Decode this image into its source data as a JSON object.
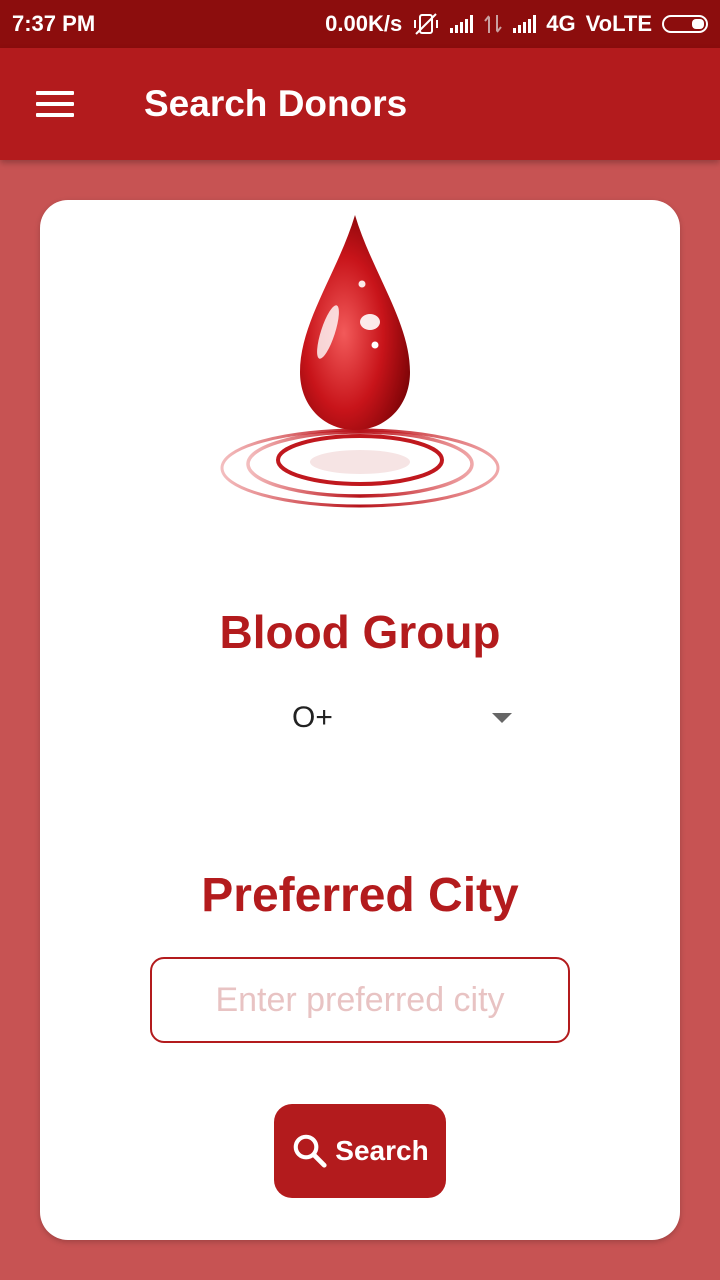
{
  "status_bar": {
    "time": "7:37 PM",
    "speed": "0.00K/s",
    "network": "4G",
    "volte": "VoLTE",
    "icons": [
      "vibrate-off-icon",
      "signal-icon",
      "data-arrows-icon",
      "signal-icon",
      "battery-icon"
    ]
  },
  "app_bar": {
    "title": "Search Donors",
    "menu_icon": "hamburger-menu-icon"
  },
  "form": {
    "logo_icon": "blood-drop-icon",
    "blood_group_label": "Blood Group",
    "blood_group_value": "O+",
    "city_label": "Preferred City",
    "city_placeholder": "Enter preferred city",
    "city_value": "",
    "search_label": "Search",
    "search_icon": "search-icon"
  },
  "colors": {
    "status_bar": "#8c0d0d",
    "app_bar": "#b31b1d",
    "background": "#c75353",
    "card": "#ffffff",
    "accent": "#b31b1d"
  }
}
